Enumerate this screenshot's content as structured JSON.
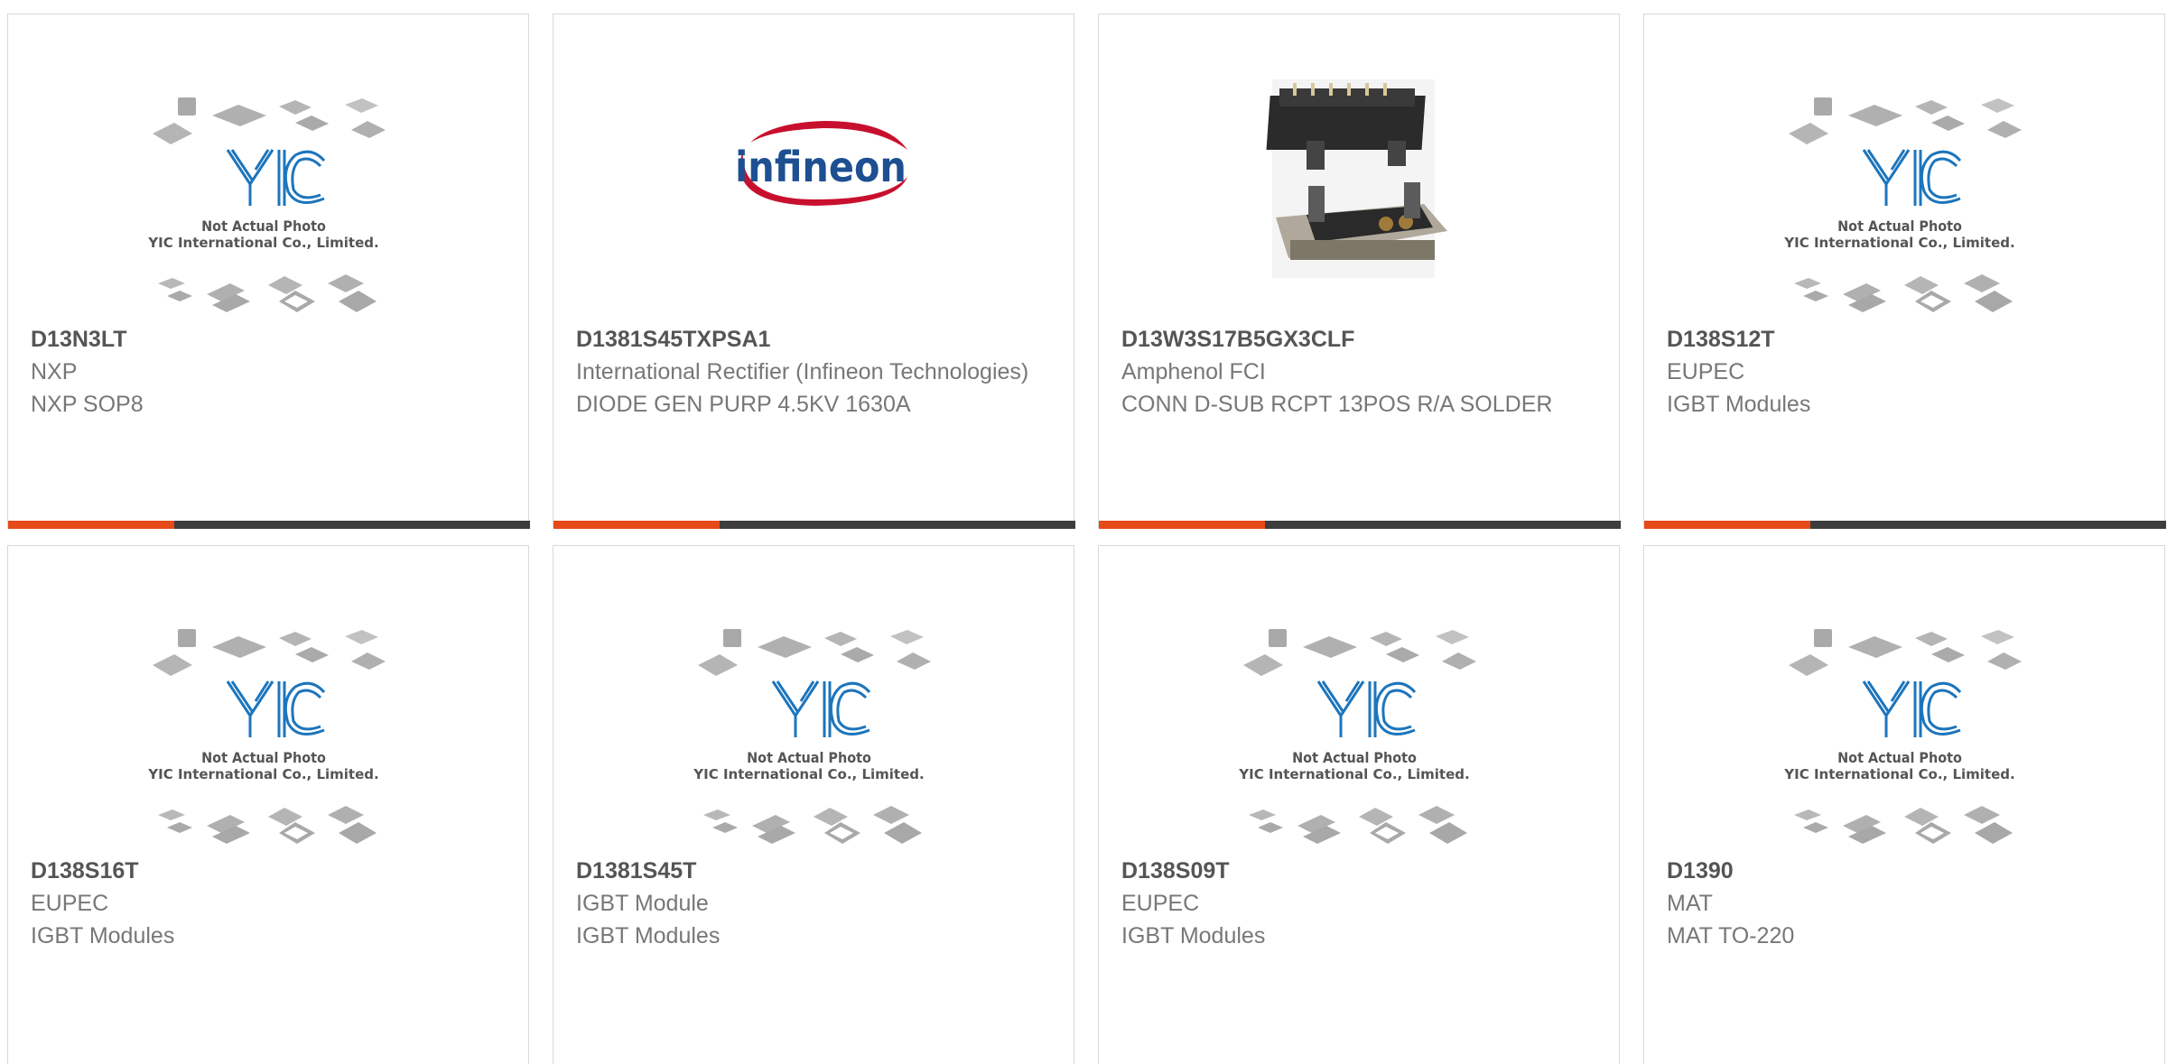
{
  "colors": {
    "accent": "#e64a19",
    "bar": "#3d3d3d",
    "part_text": "#555555",
    "meta_text": "#777777",
    "logo_blue": "#1c75bc",
    "infineon_blue": "#1d4f91",
    "infineon_red": "#c8102e"
  },
  "placeholder": {
    "line1": "Not Actual Photo",
    "line2": "YIC International Co., Limited."
  },
  "infineon_logo_text": "infineon",
  "products": [
    {
      "part": "D13N3LT",
      "manufacturer": "NXP",
      "description": "NXP SOP8",
      "image": "placeholder"
    },
    {
      "part": "D1381S45TXPSA1",
      "manufacturer": "International Rectifier (Infineon Technologies)",
      "description": "DIODE GEN PURP 4.5KV 1630A",
      "image": "infineon-logo"
    },
    {
      "part": "D13W3S17B5GX3CLF",
      "manufacturer": "Amphenol FCI",
      "description": "CONN D-SUB RCPT 13POS R/A SOLDER",
      "image": "dsub-connector-photo"
    },
    {
      "part": "D138S12T",
      "manufacturer": "EUPEC",
      "description": "IGBT Modules",
      "image": "placeholder"
    },
    {
      "part": "D138S16T",
      "manufacturer": "EUPEC",
      "description": "IGBT Modules",
      "image": "placeholder"
    },
    {
      "part": "D1381S45T",
      "manufacturer": "IGBT Module",
      "description": "IGBT Modules",
      "image": "placeholder"
    },
    {
      "part": "D138S09T",
      "manufacturer": "EUPEC",
      "description": "IGBT Modules",
      "image": "placeholder"
    },
    {
      "part": "D1390",
      "manufacturer": "MAT",
      "description": "MAT TO-220",
      "image": "placeholder"
    }
  ]
}
